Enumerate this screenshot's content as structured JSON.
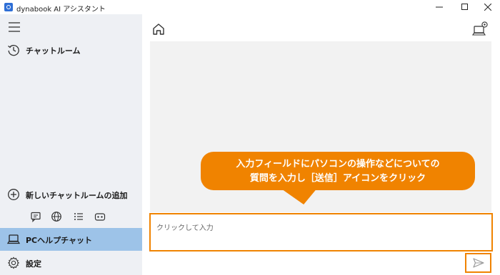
{
  "window": {
    "title": "dynabook AI アシスタント"
  },
  "sidebar": {
    "menu_icon": "hamburger-icon",
    "chatroom_label": "チャットルーム",
    "new_chatroom_label": "新しいチャットルームの追加",
    "quick_icons": [
      "chat-icon",
      "globe-icon",
      "list-icon",
      "robot-icon"
    ],
    "pc_help_label": "PCヘルプチャット",
    "settings_label": "設定"
  },
  "main": {
    "home_icon": "home-icon",
    "pc_settings_icon": "pc-settings-icon",
    "input_placeholder": "クリックして入力",
    "send_icon": "send-icon"
  },
  "callout": {
    "line1": "入力フィールドにパソコンの操作などについての",
    "line2": "質問を入力し［送信］アイコンをクリック"
  },
  "colors": {
    "accent": "#f08300",
    "sidebar_bg": "#eef0f4",
    "selected_bg": "#9dc3e8",
    "chat_bg": "#f2f2f2"
  }
}
